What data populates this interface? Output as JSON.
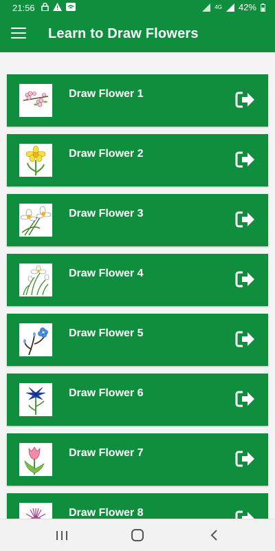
{
  "status_bar": {
    "time": "21:56",
    "battery": "42%",
    "network": "4G"
  },
  "app_bar": {
    "title": "Learn to Draw Flowers"
  },
  "items": [
    {
      "label": "Draw Flower 1",
      "icon": "cherry-blossom-icon"
    },
    {
      "label": "Draw Flower 2",
      "icon": "daffodil-icon"
    },
    {
      "label": "Draw Flower 3",
      "icon": "narcissus-icon"
    },
    {
      "label": "Draw Flower 4",
      "icon": "white-lily-icon"
    },
    {
      "label": "Draw Flower 5",
      "icon": "blue-flower-branch-icon"
    },
    {
      "label": "Draw Flower 6",
      "icon": "cornflower-icon"
    },
    {
      "label": "Draw Flower 7",
      "icon": "tulip-icon"
    },
    {
      "label": "Draw Flower 8",
      "icon": "thistle-icon"
    }
  ],
  "colors": {
    "primary": "#0f8f3d",
    "background": "#f4f4f4",
    "text_on_primary": "#ffffff"
  }
}
